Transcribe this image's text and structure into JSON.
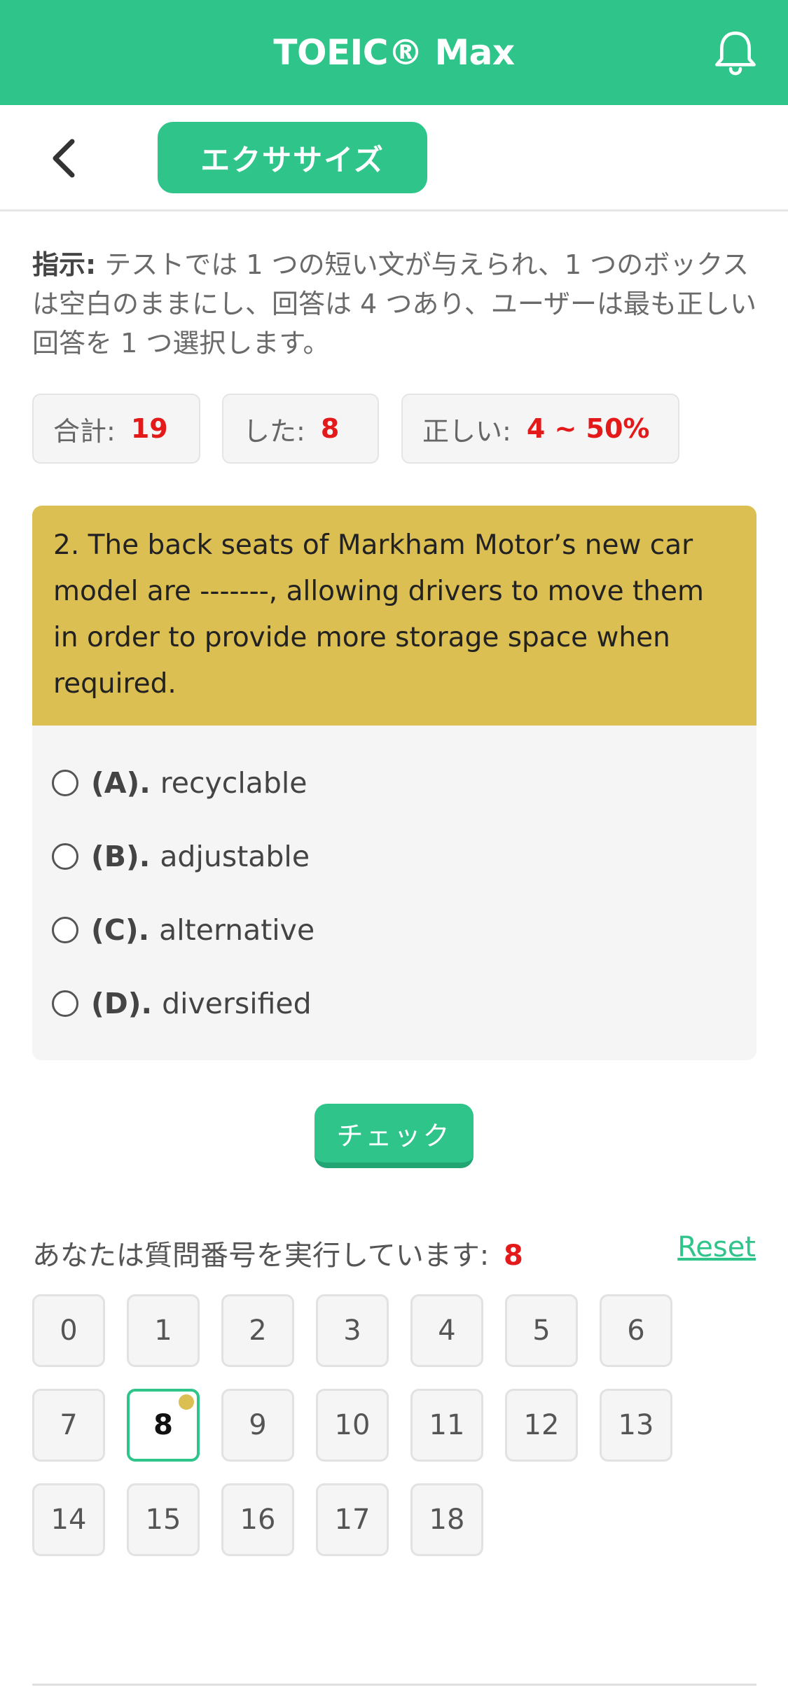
{
  "header": {
    "title": "TOEIC® Max",
    "bell_icon": "bell-icon"
  },
  "subbar": {
    "back_icon": "chevron-left-icon",
    "exercise_label": "エクササイズ"
  },
  "instructions": {
    "label": "指示:",
    "text": "テストでは 1 つの短い文が与えられ、1 つのボックスは空白のままにし、回答は 4 つあり、ユーザーは最も正しい回答を 1 つ選択します。"
  },
  "stats": {
    "total_label": "合計:",
    "total_value": "19",
    "done_label": "した:",
    "done_value": "8",
    "correct_label": "正しい:",
    "correct_value": "4 ~ 50%"
  },
  "question": {
    "text": "2. The back seats of Markham Motor’s new car model are -------, allowing drivers to move them in order to provide more storage space when required.",
    "options": [
      {
        "letter": "(A).",
        "text": "recyclable"
      },
      {
        "letter": "(B).",
        "text": "adjustable"
      },
      {
        "letter": "(C).",
        "text": "alternative"
      },
      {
        "letter": "(D).",
        "text": "diversified"
      }
    ]
  },
  "check_label": "チェック",
  "progress": {
    "label": "あなたは質問番号を実行しています:",
    "current": "8",
    "reset_label": "Reset"
  },
  "question_numbers": [
    "0",
    "1",
    "2",
    "3",
    "4",
    "5",
    "6",
    "7",
    "8",
    "9",
    "10",
    "11",
    "12",
    "13",
    "14",
    "15",
    "16",
    "17",
    "18"
  ],
  "colors": {
    "accent": "#2ec48a",
    "question_bg": "#dcbf52",
    "highlight": "#e41a1a"
  }
}
